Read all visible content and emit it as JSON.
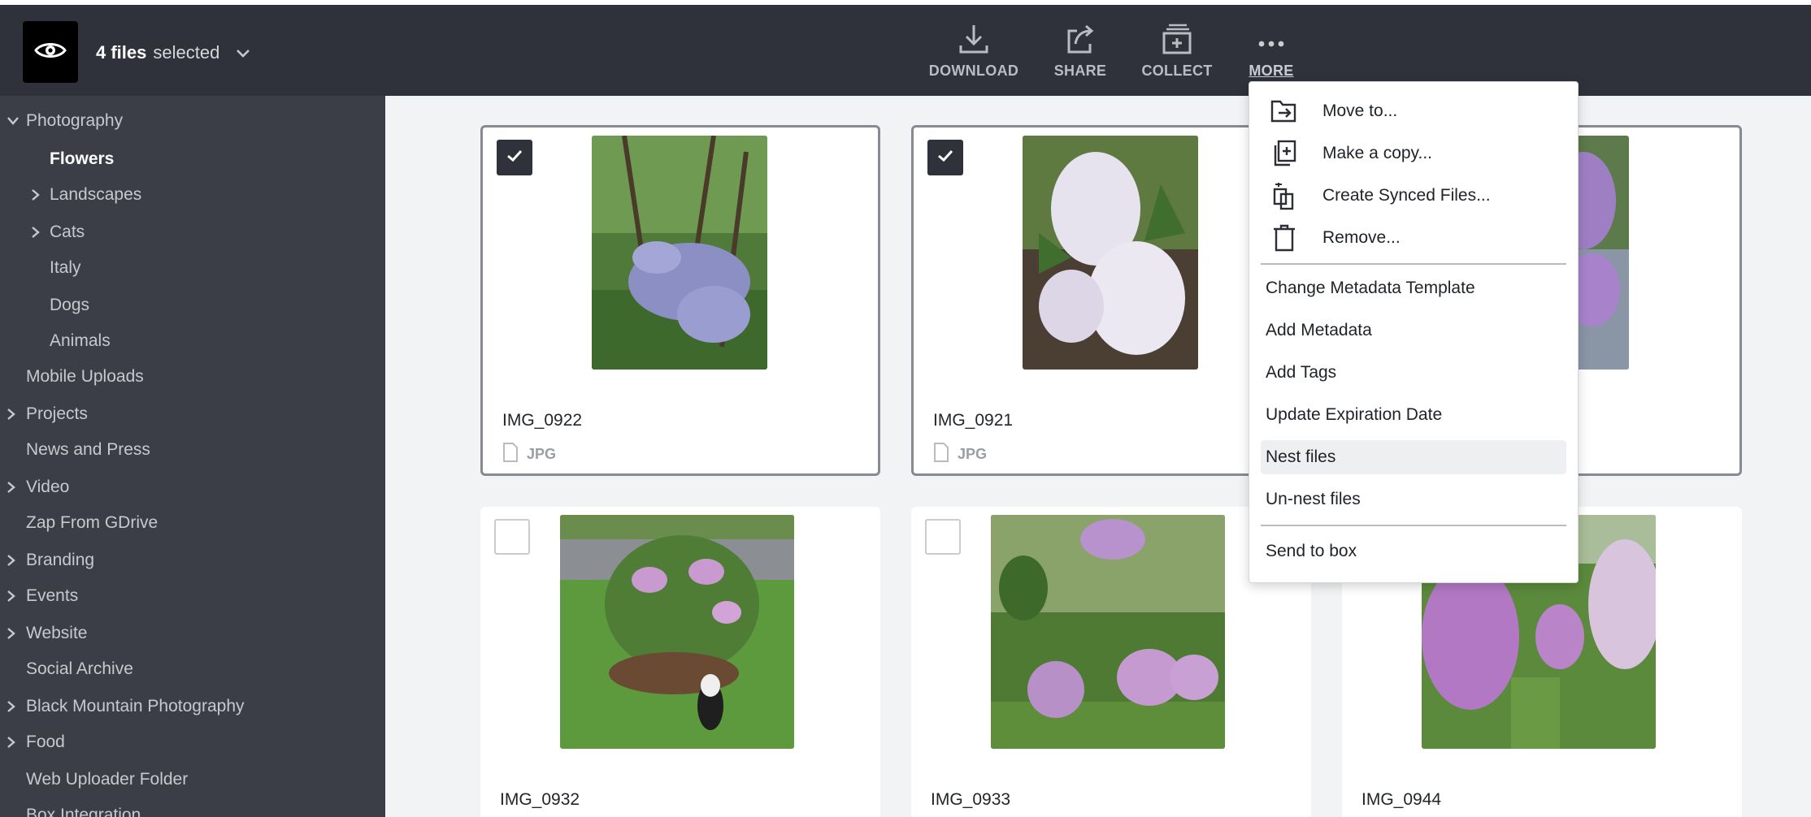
{
  "topbar": {
    "selection_count": "4 files",
    "selection_suffix": "selected",
    "tools": [
      {
        "label": "DOWNLOAD",
        "icon": "download-icon"
      },
      {
        "label": "SHARE",
        "icon": "share-icon"
      },
      {
        "label": "COLLECT",
        "icon": "collect-icon"
      },
      {
        "label": "MORE",
        "icon": "more-dots-icon"
      }
    ]
  },
  "sidebar": {
    "items": [
      {
        "label": "Photography",
        "expanded": true
      },
      {
        "label": "Flowers",
        "active": true
      },
      {
        "label": "Landscapes",
        "collapsed": true
      },
      {
        "label": "Cats",
        "collapsed": true
      },
      {
        "label": "Italy"
      },
      {
        "label": "Dogs"
      },
      {
        "label": "Animals"
      },
      {
        "label": "Mobile Uploads"
      },
      {
        "label": "Projects",
        "collapsed": true
      },
      {
        "label": "News and Press"
      },
      {
        "label": "Video",
        "collapsed": true
      },
      {
        "label": "Zap From GDrive"
      },
      {
        "label": "Branding",
        "collapsed": true
      },
      {
        "label": "Events",
        "collapsed": true
      },
      {
        "label": "Website",
        "collapsed": true
      },
      {
        "label": "Social Archive"
      },
      {
        "label": "Black Mountain Photography",
        "collapsed": true
      },
      {
        "label": "Food",
        "collapsed": true
      },
      {
        "label": "Web Uploader Folder"
      },
      {
        "label": "Box Integration"
      }
    ]
  },
  "files": [
    {
      "name": "IMG_0922",
      "type": "JPG",
      "selected": true
    },
    {
      "name": "IMG_0921",
      "type": "JPG",
      "selected": true
    },
    {
      "name": "",
      "type": "",
      "selected": true
    },
    {
      "name": "IMG_0932",
      "type": "",
      "selected": false
    },
    {
      "name": "IMG_0933",
      "type": "",
      "selected": false
    },
    {
      "name": "IMG_0944",
      "type": "",
      "selected": false
    }
  ],
  "menu": {
    "items": [
      {
        "label": "Move to...",
        "icon": "move-folder-icon"
      },
      {
        "label": "Make a copy...",
        "icon": "copy-icon"
      },
      {
        "label": "Create Synced Files...",
        "icon": "sync-icon"
      },
      {
        "label": "Remove...",
        "icon": "trash-icon"
      },
      {
        "label": "Change Metadata Template"
      },
      {
        "label": "Add Metadata"
      },
      {
        "label": "Add Tags"
      },
      {
        "label": "Update Expiration Date"
      },
      {
        "label": "Nest files",
        "hovered": true
      },
      {
        "label": "Un-nest files"
      },
      {
        "label": "Send to box"
      }
    ]
  },
  "colors": {
    "topbar": "#2f323a",
    "sidebar": "#3b3e46",
    "content": "#f2f3f5",
    "check_on": "#2f323a"
  }
}
